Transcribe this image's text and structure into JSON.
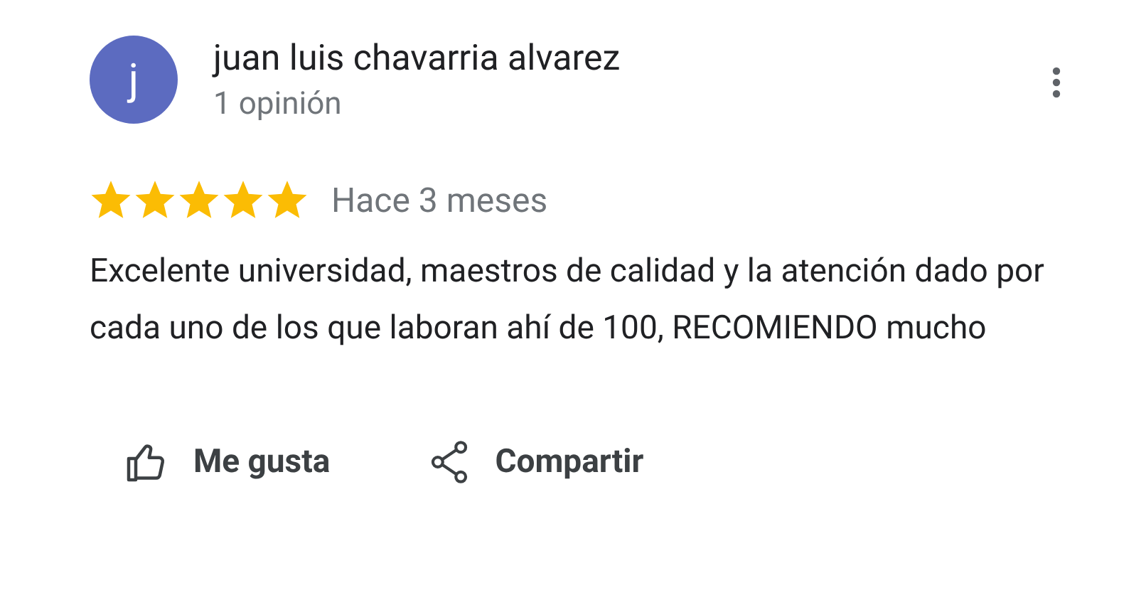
{
  "review": {
    "avatar_letter": "j",
    "author": "juan luis chavarria alvarez",
    "author_meta": "1 opinión",
    "stars": 5,
    "time": "Hace 3 meses",
    "text": "Excelente universidad, maestros de calidad y la atención dado por cada uno de los que laboran ahí de 100, RECOMIENDO mucho"
  },
  "actions": [
    {
      "kind": "like",
      "label": "Me gusta"
    },
    {
      "kind": "share",
      "label": "Compartir"
    }
  ]
}
